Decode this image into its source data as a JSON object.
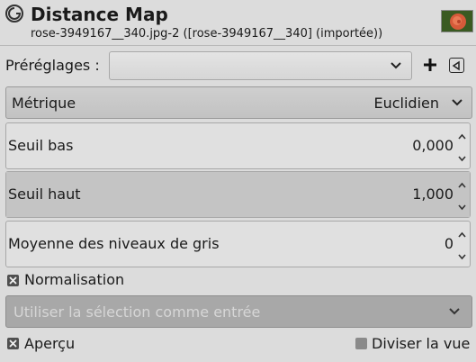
{
  "header": {
    "title": "Distance Map",
    "subtitle": "rose-3949167__340.jpg-2 ([rose-3949167__340] (importée))"
  },
  "presets": {
    "label": "Préréglages :",
    "value": "",
    "add_icon": "plus-icon",
    "menu_icon": "menu-left-icon"
  },
  "metric": {
    "label": "Métrique",
    "value": "Euclidien"
  },
  "spinboxes": [
    {
      "label": "Seuil bas",
      "value": "0,000",
      "fraction": 0.0
    },
    {
      "label": "Seuil haut",
      "value": "1,000",
      "fraction": 1.0
    },
    {
      "label": "Moyenne des niveaux de gris",
      "value": "0",
      "fraction": 0.0
    }
  ],
  "normalisation": {
    "label": "Normalisation",
    "checked": true
  },
  "input_source": {
    "value": "Utiliser la sélection comme entrée",
    "disabled": true
  },
  "preview": {
    "label": "Aperçu",
    "checked": true
  },
  "split_view": {
    "label": "Diviser la vue",
    "checked": false
  }
}
